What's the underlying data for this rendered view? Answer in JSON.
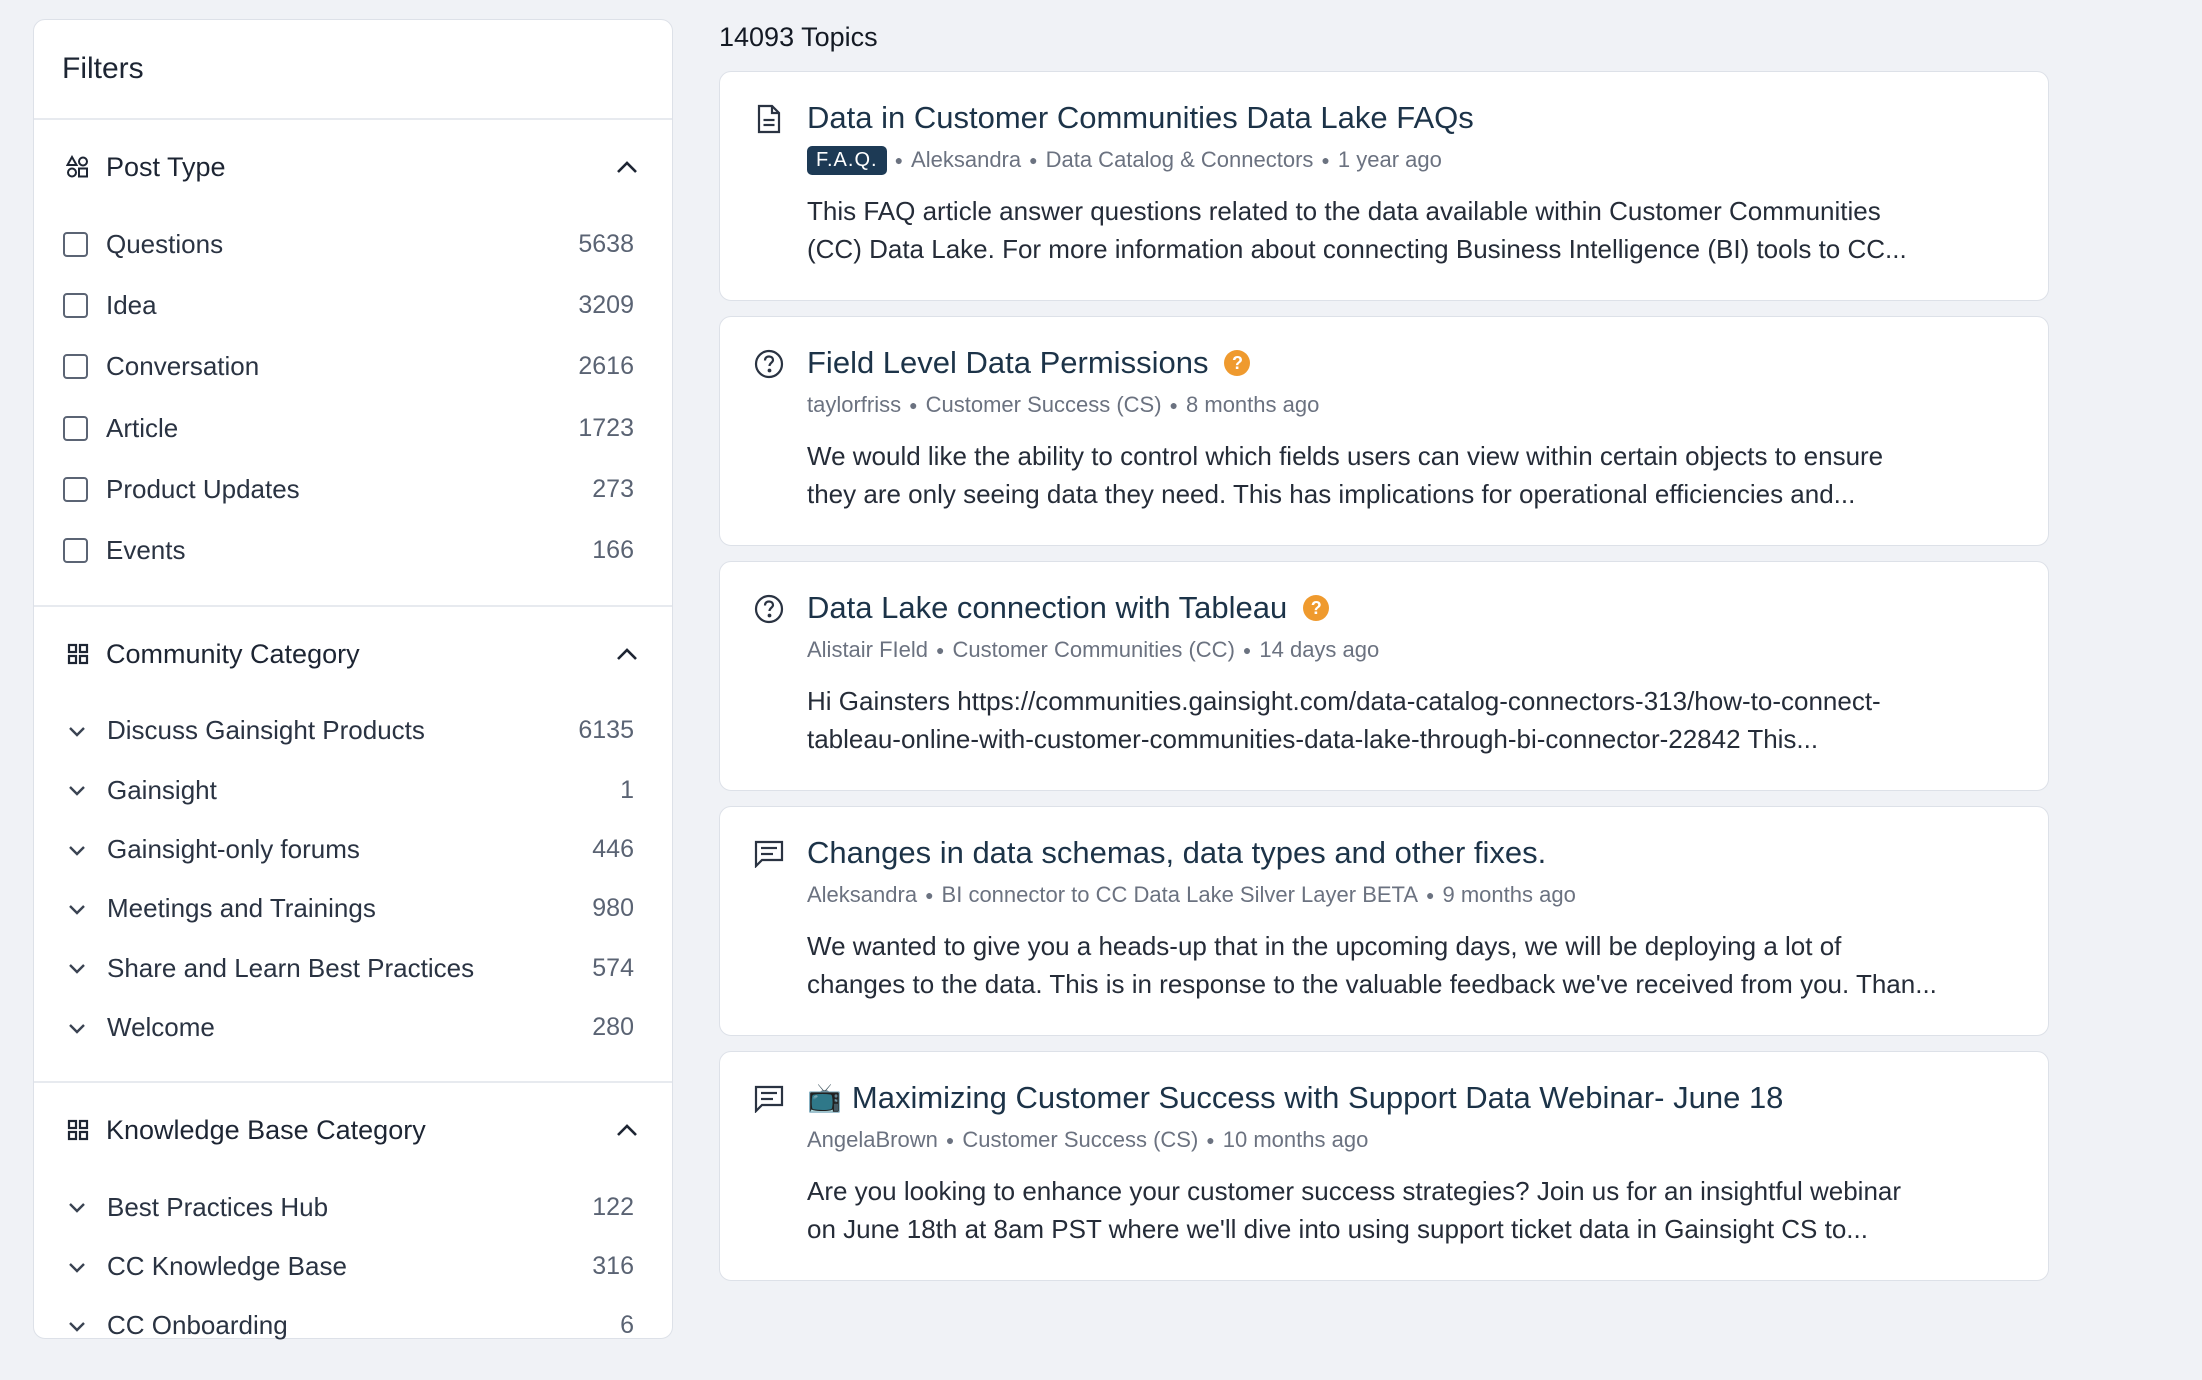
{
  "filters": {
    "title": "Filters",
    "post_type": {
      "title": "Post Type",
      "items": [
        {
          "label": "Questions",
          "count": "5638"
        },
        {
          "label": "Idea",
          "count": "3209"
        },
        {
          "label": "Conversation",
          "count": "2616"
        },
        {
          "label": "Article",
          "count": "1723"
        },
        {
          "label": "Product Updates",
          "count": "273"
        },
        {
          "label": "Events",
          "count": "166"
        }
      ]
    },
    "community_category": {
      "title": "Community Category",
      "items": [
        {
          "label": "Discuss Gainsight Products",
          "count": "6135"
        },
        {
          "label": "Gainsight",
          "count": "1"
        },
        {
          "label": "Gainsight-only forums",
          "count": "446"
        },
        {
          "label": "Meetings and Trainings",
          "count": "980"
        },
        {
          "label": "Share and Learn Best Practices",
          "count": "574"
        },
        {
          "label": "Welcome",
          "count": "280"
        }
      ]
    },
    "kb_category": {
      "title": "Knowledge Base Category",
      "items": [
        {
          "label": "Best Practices Hub",
          "count": "122"
        },
        {
          "label": "CC Knowledge Base",
          "count": "316"
        },
        {
          "label": "CC Onboarding",
          "count": "6"
        }
      ]
    }
  },
  "topics": {
    "count_label": "14093 Topics",
    "items": [
      {
        "icon": "document-icon",
        "title": "Data in Customer Communities Data Lake FAQs",
        "tag": "F.A.Q.",
        "author": "Aleksandra",
        "category": "Data Catalog & Connectors",
        "time": "1 year ago",
        "excerpt_1": "This FAQ article answer questions related to the data available within Customer Communities",
        "excerpt_2": "(CC) Data Lake. For more information about connecting Business Intelligence (BI) tools to CC..."
      },
      {
        "icon": "question-circle-icon",
        "title": "Field Level Data Permissions",
        "badge": "?",
        "author": "taylorfriss",
        "category": "Customer Success (CS)",
        "time": "8 months ago",
        "excerpt_1": "We would like the ability to control which fields users can view within certain objects to ensure",
        "excerpt_2": "they are only seeing data they need. This has implications for operational efficiencies and..."
      },
      {
        "icon": "question-circle-icon",
        "title": "Data Lake connection with Tableau",
        "badge": "?",
        "author": "Alistair FIeld",
        "category": "Customer Communities (CC)",
        "time": "14 days ago",
        "excerpt_1": "Hi Gainsters https://communities.gainsight.com/data-catalog-connectors-313/how-to-connect-",
        "excerpt_2": "tableau-online-with-customer-communities-data-lake-through-bi-connector-22842 This..."
      },
      {
        "icon": "conversation-icon",
        "title": "Changes in data schemas, data types and other fixes.",
        "author": "Aleksandra",
        "category": "BI connector to CC Data Lake Silver Layer BETA",
        "time": "9 months ago",
        "excerpt_1": "We wanted to give you a heads-up that in the upcoming days, we will be deploying a lot of",
        "excerpt_2": "changes to the data. This is in response to the valuable feedback we've received from you. Than..."
      },
      {
        "icon": "conversation-icon",
        "emoji": "📺",
        "title": "Maximizing Customer Success with Support Data Webinar- June 18",
        "author": "AngelaBrown",
        "category": "Customer Success (CS)",
        "time": "10 months ago",
        "excerpt_1": "Are you looking to enhance your customer success strategies? Join us for an insightful webinar",
        "excerpt_2": "on June 18th at 8am PST where we'll dive into using support ticket data in Gainsight CS to..."
      }
    ]
  }
}
